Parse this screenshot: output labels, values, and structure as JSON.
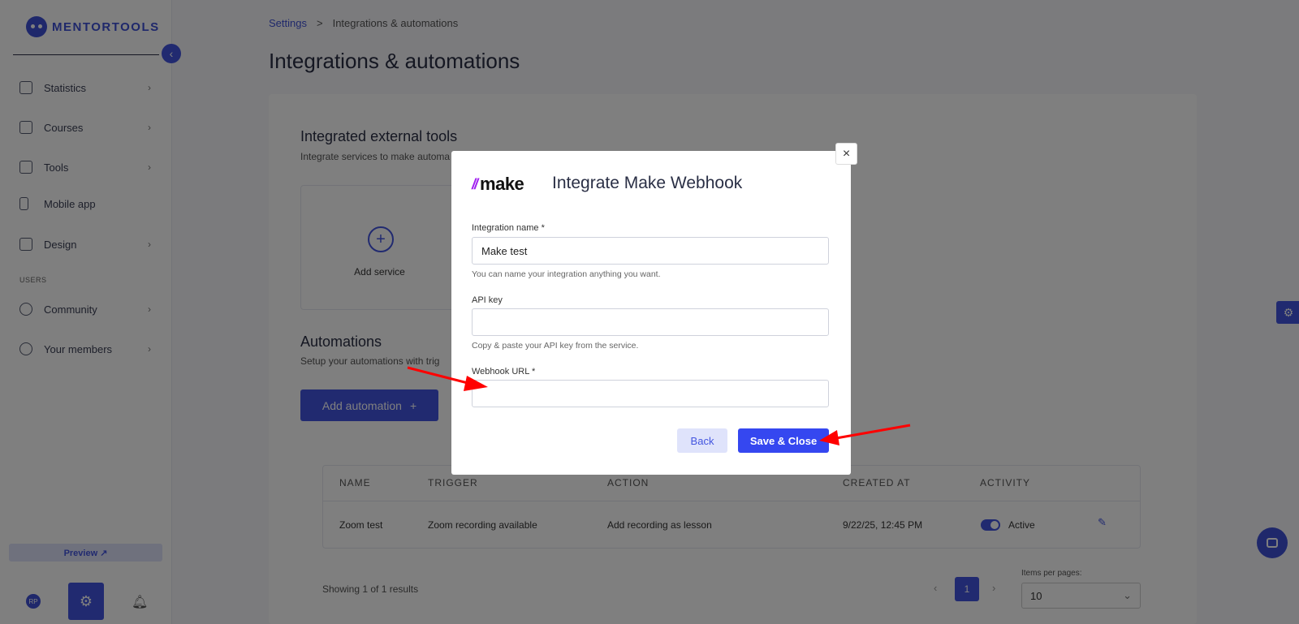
{
  "brand": {
    "name": "MENTORTOOLS"
  },
  "sidebar": {
    "collapse_icon": "‹",
    "items": [
      {
        "label": "Statistics",
        "icon": "bar-chart-icon"
      },
      {
        "label": "Courses",
        "icon": "book-icon"
      },
      {
        "label": "Tools",
        "icon": "megaphone-icon"
      },
      {
        "label": "Mobile app",
        "icon": "phone-icon"
      },
      {
        "label": "Design",
        "icon": "pencil-icon"
      },
      {
        "label": "Community",
        "icon": "people-icon"
      },
      {
        "label": "Your members",
        "icon": "user-icon"
      }
    ],
    "section_users": "USERS",
    "preview_label": "Preview ↗",
    "avatar_initials": "RP"
  },
  "breadcrumb": {
    "root": "Settings",
    "separator": ">",
    "current": "Integrations & automations"
  },
  "page": {
    "title": "Integrations & automations"
  },
  "integrated": {
    "title": "Integrated external tools",
    "subtitle": "Integrate services to make automa",
    "add_service_label": "Add service"
  },
  "automations": {
    "title": "Automations",
    "subtitle": "Setup your automations with trig",
    "add_button": "Add automation",
    "columns": [
      "NAME",
      "TRIGGER",
      "ACTION",
      "CREATED AT",
      "ACTIVITY"
    ],
    "rows": [
      {
        "name": "Zoom test",
        "trigger": "Zoom recording available",
        "action": "Add recording as lesson",
        "created_at": "9/22/25, 12:45 PM",
        "activity": "Active"
      }
    ],
    "results_text": "Showing 1 of 1 results",
    "current_page": "1",
    "items_per_page_label": "Items per pages:",
    "items_per_page_value": "10"
  },
  "modal": {
    "brand_mark": "//",
    "brand_word": "make",
    "title": "Integrate Make Webhook",
    "fields": [
      {
        "label": "Integration name *",
        "value": "Make test",
        "help": "You can name your integration anything you want."
      },
      {
        "label": "API key",
        "value": "",
        "help": "Copy & paste your API key from the service."
      },
      {
        "label": "Webhook URL *",
        "value": "",
        "help": ""
      }
    ],
    "back_label": "Back",
    "save_label": "Save & Close",
    "close_icon": "×"
  },
  "colors": {
    "accent": "#4355e0",
    "primary_button": "#3547f0",
    "annotation_arrow": "#ff0000"
  }
}
